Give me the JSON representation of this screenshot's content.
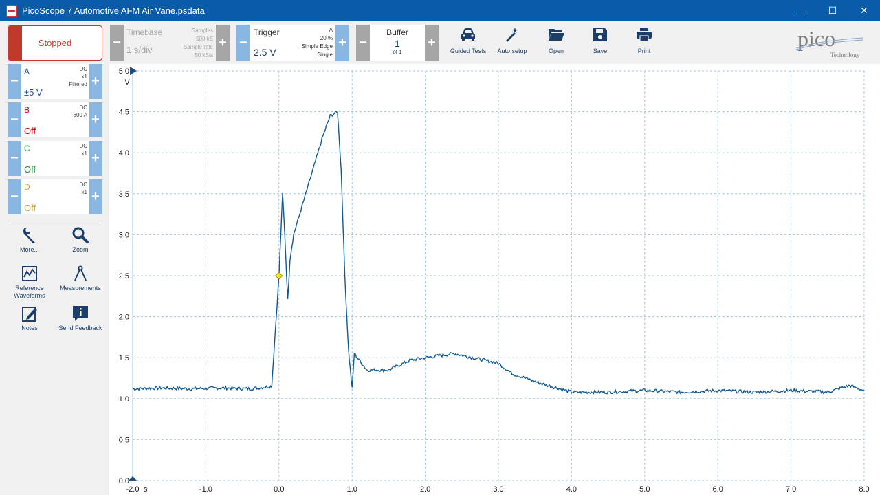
{
  "window": {
    "title": "PicoScope 7 Automotive AFM Air Vane.psdata",
    "minimize": "—",
    "maximize": "☐",
    "close": "✕"
  },
  "toolbar": {
    "stop_label": "Stopped",
    "timebase": {
      "label": "Timebase",
      "value": "1 s/div",
      "samples_label": "Samples",
      "samples_value": "500 kS",
      "rate_label": "Sample rate",
      "rate_value": "50 kS/s"
    },
    "trigger": {
      "label": "Trigger",
      "value": "2.5 V",
      "channel": "A",
      "pretrigger": "20 %",
      "type": "Simple Edge",
      "mode": "Single"
    },
    "buffer": {
      "label": "Buffer",
      "value": "1",
      "of": "of 1"
    },
    "buttons": {
      "guided_tests": "Guided Tests",
      "auto_setup": "Auto setup",
      "open": "Open",
      "save": "Save",
      "print": "Print"
    },
    "minus": "−",
    "plus": "+",
    "logo_text": "pico",
    "logo_sub": "Technology"
  },
  "channels": [
    {
      "name": "A",
      "range": "±5 V",
      "coupling": "DC",
      "probe": "x1",
      "extra": "Filtered",
      "color": "#1b4f8a"
    },
    {
      "name": "B",
      "range": "Off",
      "coupling": "DC",
      "probe": "600 A",
      "extra": "",
      "color": "#c0000c"
    },
    {
      "name": "C",
      "range": "Off",
      "coupling": "DC",
      "probe": "x1",
      "extra": "",
      "color": "#1e8a3b"
    },
    {
      "name": "D",
      "range": "Off",
      "coupling": "DC",
      "probe": "x1",
      "extra": "",
      "color": "#c4a23a"
    }
  ],
  "sidebar_tools": {
    "more": "More...",
    "zoom": "Zoom",
    "reference": "Reference Waveforms",
    "measurements": "Measurements",
    "notes": "Notes",
    "feedback": "Send Feedback"
  },
  "chart_data": {
    "type": "line",
    "x_unit": "s",
    "y_unit": "V",
    "xlim": [
      -2.0,
      8.0
    ],
    "ylim": [
      0.0,
      5.0
    ],
    "x_ticks": [
      "-2.0",
      "-1.0",
      "0.0",
      "1.0",
      "2.0",
      "3.0",
      "4.0",
      "5.0",
      "6.0",
      "7.0",
      "8.0"
    ],
    "y_ticks": [
      "0.0",
      "0.5",
      "1.0",
      "1.5",
      "2.0",
      "2.5",
      "3.0",
      "3.5",
      "4.0",
      "4.5",
      "5.0"
    ],
    "grid": true,
    "trigger_point": {
      "x": 0.0,
      "y": 2.5
    },
    "series": [
      {
        "color": "#0e5a96",
        "x": [
          -2.0,
          -1.6,
          -1.2,
          -0.8,
          -0.4,
          -0.1,
          0.0,
          0.05,
          0.08,
          0.12,
          0.15,
          0.2,
          0.3,
          0.4,
          0.5,
          0.6,
          0.7,
          0.8,
          0.85,
          0.9,
          0.95,
          1.0,
          1.03,
          1.2,
          1.5,
          1.8,
          2.0,
          2.4,
          2.8,
          3.0,
          3.2,
          3.6,
          4.0,
          4.5,
          5.0,
          5.5,
          6.0,
          6.5,
          7.0,
          7.5,
          7.8,
          8.0
        ],
        "y": [
          1.12,
          1.13,
          1.12,
          1.13,
          1.12,
          1.15,
          2.5,
          3.5,
          3.0,
          2.2,
          2.7,
          3.0,
          3.3,
          3.6,
          3.9,
          4.2,
          4.45,
          4.5,
          3.8,
          2.5,
          1.6,
          1.12,
          1.55,
          1.35,
          1.35,
          1.47,
          1.5,
          1.55,
          1.47,
          1.43,
          1.3,
          1.18,
          1.08,
          1.08,
          1.1,
          1.08,
          1.1,
          1.08,
          1.1,
          1.08,
          1.16,
          1.1
        ]
      }
    ]
  }
}
